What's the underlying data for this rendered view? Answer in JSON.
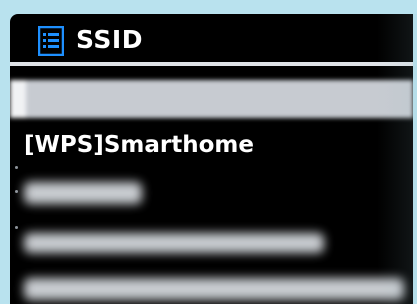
{
  "header": {
    "title": "SSID",
    "icon": "list-icon"
  },
  "networks": {
    "selected_label": "",
    "items": [
      {
        "label": "[WPS]Smarthome"
      }
    ]
  },
  "colors": {
    "frame": "#b9e2ee",
    "screen": "#000000",
    "text": "#ffffff",
    "divider": "#dfe3e8",
    "selection": "#c7cbd1"
  }
}
